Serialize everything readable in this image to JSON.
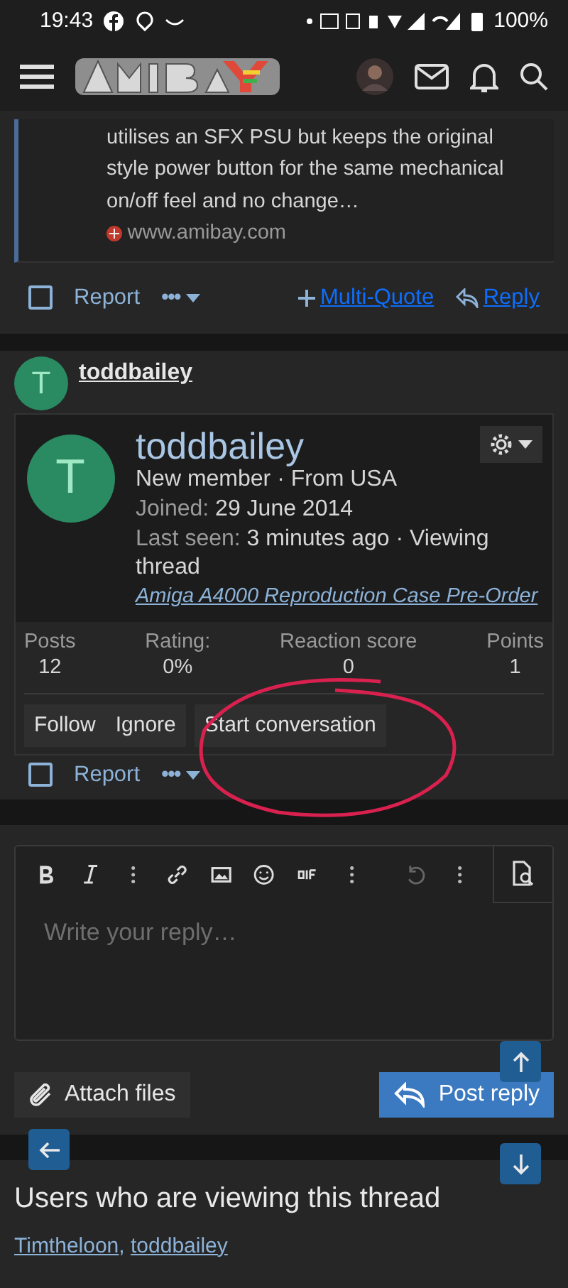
{
  "status_bar": {
    "time": "19:43",
    "battery": "100%"
  },
  "quoted_post": {
    "text": "utilises an SFX PSU but keeps the original style power button for the same mechanical on/off feel and no change…",
    "source": "www.amibay.com"
  },
  "post_actions": {
    "checked": false,
    "report": "Report",
    "more": "•••",
    "multi_quote": "Multi-Quote",
    "reply": "Reply"
  },
  "next_post": {
    "avatar_letter": "T",
    "username": "toddbailey",
    "report": "Report",
    "more": "•••",
    "checked": false
  },
  "member_card": {
    "avatar_letter": "T",
    "username": "toddbailey",
    "subtitle": "New member · From USA",
    "joined_label": "Joined:",
    "joined": "29 June 2014",
    "last_seen_label": "Last seen:",
    "last_seen": "3 minutes ago · Viewing thread",
    "thread_link": "Amiga A4000 Reproduction Case Pre-Order",
    "stats": [
      {
        "label": "Posts",
        "value": "12"
      },
      {
        "label": "Rating:",
        "value": "0%"
      },
      {
        "label": "Reaction score",
        "value": "0"
      },
      {
        "label": "Points",
        "value": "1"
      }
    ],
    "buttons": [
      "Follow",
      "Ignore",
      "Start conversation"
    ]
  },
  "editor": {
    "placeholder": "Write your reply…",
    "attach": "Attach files",
    "post": "Post reply"
  },
  "viewers": {
    "title": "Users who are viewing this thread",
    "users": [
      "Timtheloon",
      "toddbailey"
    ],
    "separator": ","
  }
}
